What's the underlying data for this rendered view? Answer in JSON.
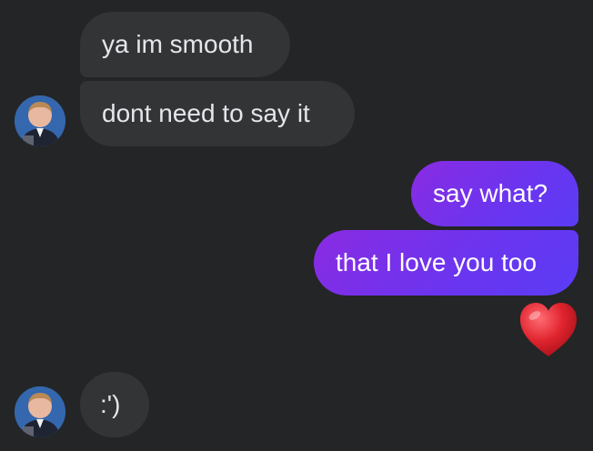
{
  "messages": [
    {
      "id": "m1",
      "direction": "incoming",
      "text": "ya im smooth"
    },
    {
      "id": "m2",
      "direction": "incoming",
      "text": "dont need to say it"
    },
    {
      "id": "m3",
      "direction": "outgoing",
      "text": "say what?"
    },
    {
      "id": "m4",
      "direction": "outgoing",
      "text": "that I love you too"
    },
    {
      "id": "m5",
      "direction": "outgoing",
      "reaction": "red-heart-emoji"
    },
    {
      "id": "m6",
      "direction": "incoming",
      "text": ":')"
    }
  ],
  "colors": {
    "background": "#242526",
    "incoming_bubble": "#333436",
    "incoming_text": "#e4e6eb",
    "outgoing_bubble": "#6a35f0",
    "outgoing_text": "#ffffff",
    "heart": "#e0242e"
  }
}
